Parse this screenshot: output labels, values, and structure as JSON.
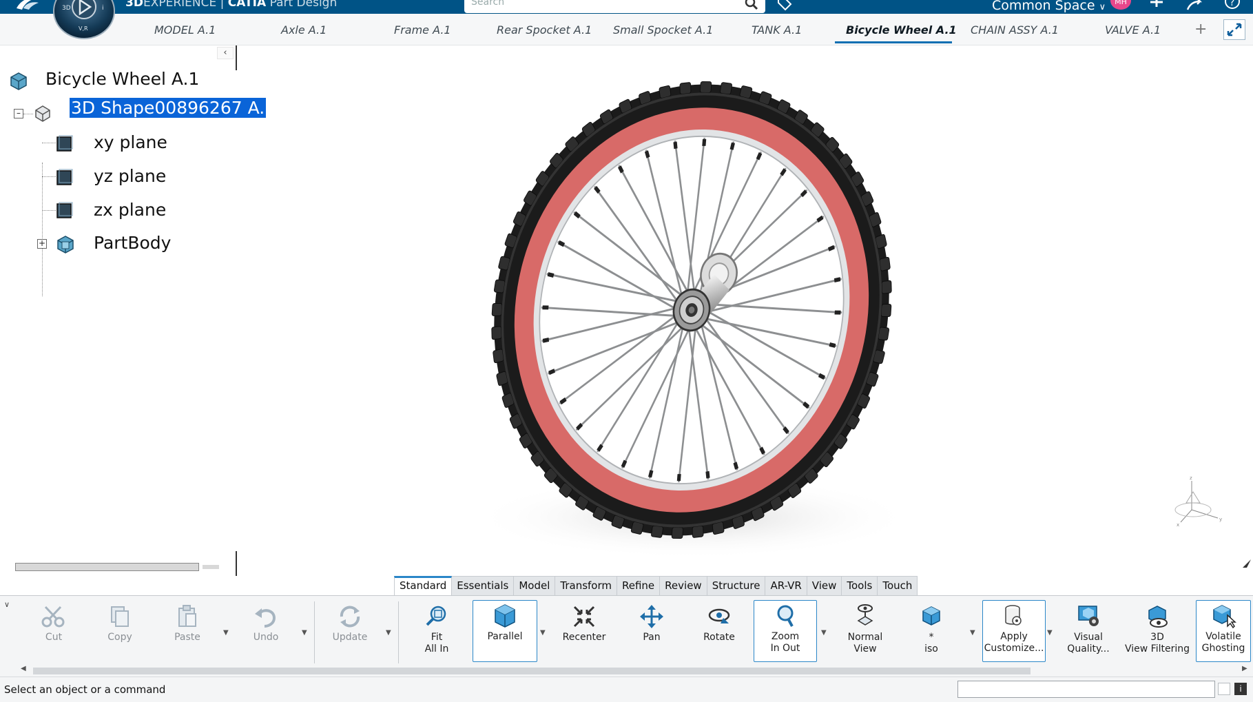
{
  "app": {
    "brand_bold": "3D",
    "brand_light": "EXPERIENCE | ",
    "brand_app": "CATIA",
    "brand_module": " Part Design",
    "search_placeholder": "Search",
    "space_label": "Common Space",
    "avatar_initials": "MH"
  },
  "tabs": [
    {
      "label": "MODEL A.1",
      "active": false
    },
    {
      "label": "Axle A.1",
      "active": false
    },
    {
      "label": "Frame A.1",
      "active": false
    },
    {
      "label": "Rear Spocket A.1",
      "active": false
    },
    {
      "label": "Small Spocket A.1",
      "active": false
    },
    {
      "label": "TANK A.1",
      "active": false
    },
    {
      "label": "Bicycle Wheel A.1",
      "active": true
    },
    {
      "label": "CHAIN ASSY A.1",
      "active": false
    },
    {
      "label": "VALVE A.1",
      "active": false
    }
  ],
  "tab_add": "+",
  "tree": {
    "collapse": "‹",
    "root": "Bicycle Wheel A.1",
    "shape": "3D Shape00896267 A.",
    "children": [
      "xy plane",
      "yz plane",
      "zx plane"
    ],
    "body": "PartBody"
  },
  "section_tabs": [
    {
      "label": "Standard",
      "active": true
    },
    {
      "label": "Essentials",
      "active": false
    },
    {
      "label": "Model",
      "active": false
    },
    {
      "label": "Transform",
      "active": false
    },
    {
      "label": "Refine",
      "active": false
    },
    {
      "label": "Review",
      "active": false
    },
    {
      "label": "Structure",
      "active": false
    },
    {
      "label": "AR-VR",
      "active": false
    },
    {
      "label": "View",
      "active": false
    },
    {
      "label": "Tools",
      "active": false
    },
    {
      "label": "Touch",
      "active": false
    }
  ],
  "actions": {
    "cut": "Cut",
    "copy": "Copy",
    "paste": "Paste",
    "undo": "Undo",
    "update": "Update",
    "fit_all_in_1": "Fit",
    "fit_all_in_2": "All In",
    "parallel": "Parallel",
    "recenter": "Recenter",
    "pan": "Pan",
    "rotate": "Rotate",
    "zoom_1": "Zoom",
    "zoom_2": "In Out",
    "normal_1": "Normal",
    "normal_2": "View",
    "iso_1": "*",
    "iso_2": "iso",
    "apply_1": "Apply",
    "apply_2": "Customize...",
    "visual_1": "Visual",
    "visual_2": "Quality...",
    "filter_1": "3D",
    "filter_2": "View Filtering",
    "ghost_1": "Volatile",
    "ghost_2": "Ghosting"
  },
  "status": {
    "text": "Select an object or a command"
  },
  "colors": {
    "topbar": "#005386",
    "tire": "#1e1e1e",
    "rim_band": "#d86a68",
    "selection": "#0a64d8",
    "accent": "#2a86c8"
  }
}
